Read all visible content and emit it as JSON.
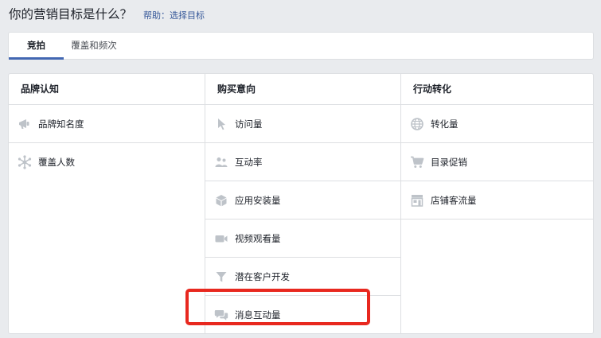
{
  "header": {
    "title": "你的营销目标是什么？",
    "help_link": "帮助：选择目标"
  },
  "tabs": [
    {
      "label": "竞拍",
      "active": true
    },
    {
      "label": "覆盖和频次",
      "active": false
    }
  ],
  "columns": [
    {
      "title": "品牌认知",
      "items": [
        {
          "label": "品牌知名度",
          "icon": "megaphone-icon"
        },
        {
          "label": "覆盖人数",
          "icon": "reach-icon"
        }
      ]
    },
    {
      "title": "购买意向",
      "items": [
        {
          "label": "访问量",
          "icon": "cursor-icon"
        },
        {
          "label": "互动率",
          "icon": "people-icon"
        },
        {
          "label": "应用安装量",
          "icon": "box-icon"
        },
        {
          "label": "视频观看量",
          "icon": "video-camera-icon"
        },
        {
          "label": "潜在客户开发",
          "icon": "funnel-icon"
        },
        {
          "label": "消息互动量",
          "icon": "chat-bubbles-icon"
        }
      ]
    },
    {
      "title": "行动转化",
      "items": [
        {
          "label": "转化量",
          "icon": "globe-icon"
        },
        {
          "label": "目录促销",
          "icon": "cart-icon"
        },
        {
          "label": "店铺客流量",
          "icon": "store-icon"
        }
      ]
    }
  ],
  "colors": {
    "accent": "#4267b2",
    "link": "#365899",
    "icon": "#bec3c9",
    "highlight": "#e8281f"
  }
}
